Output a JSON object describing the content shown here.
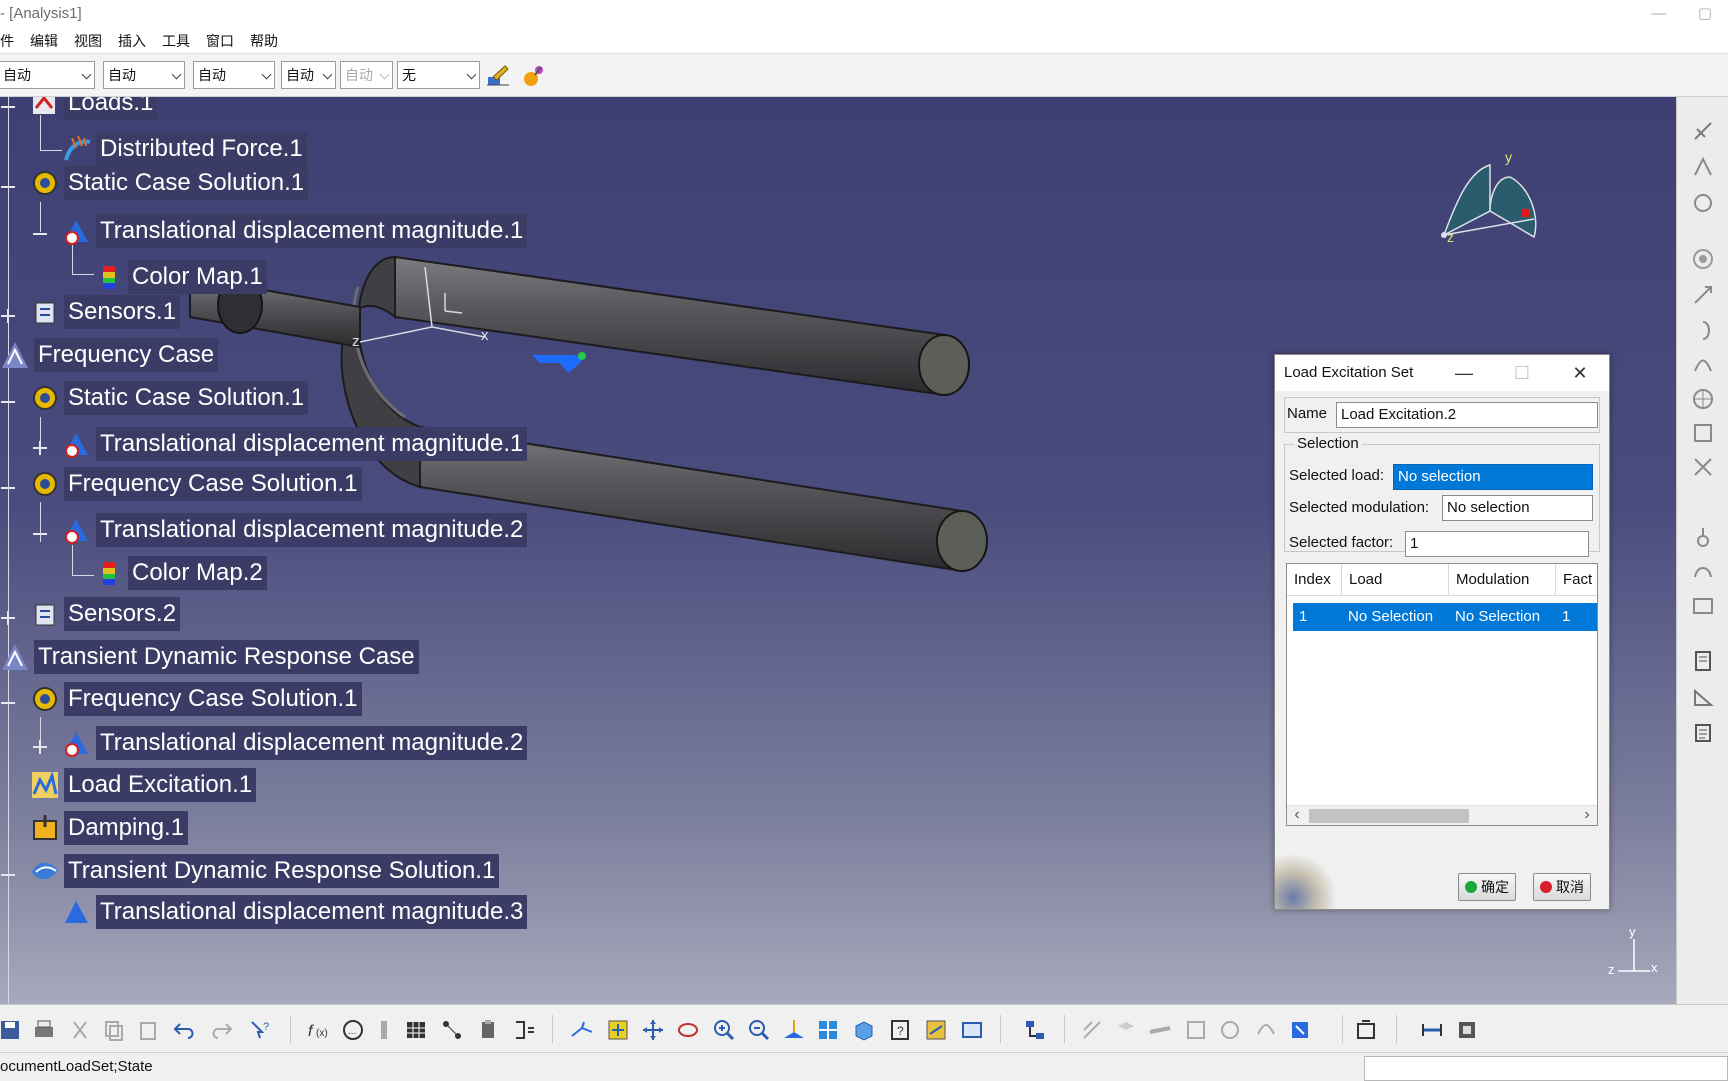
{
  "titlebar": {
    "title": "- [Analysis1]",
    "minimize": "—",
    "maximize": "▢"
  },
  "menu": [
    "件",
    "编辑",
    "视图",
    "插入",
    "工具",
    "窗口",
    "帮助"
  ],
  "toolbar": {
    "combos": [
      {
        "value": "自动",
        "disabled": false
      },
      {
        "value": "自动",
        "disabled": false
      },
      {
        "value": "自动",
        "disabled": false
      },
      {
        "value": "自动",
        "disabled": false
      },
      {
        "value": "自动",
        "disabled": true
      },
      {
        "value": "无",
        "disabled": false
      }
    ],
    "icons": [
      "paint-brush-icon",
      "properties-painter-icon"
    ]
  },
  "tree": {
    "nodes": [
      {
        "label": "Loads.1",
        "icon": "loads-icon",
        "expander": "minus"
      },
      {
        "label": "Distributed Force.1",
        "icon": "distributed-force-icon",
        "expander": ""
      },
      {
        "label": "Static Case Solution.1",
        "icon": "solution-gear-icon",
        "expander": "minus"
      },
      {
        "label": "Translational displacement magnitude.1",
        "icon": "displacement-image-icon",
        "expander": "minus"
      },
      {
        "label": "Color Map.1",
        "icon": "color-map-icon",
        "expander": ""
      },
      {
        "label": "Sensors.1",
        "icon": "sensors-icon",
        "expander": "plus"
      },
      {
        "label": "Frequency Case",
        "icon": "case-icon",
        "expander": ""
      },
      {
        "label": "Static Case Solution.1",
        "icon": "solution-gear-icon",
        "expander": "minus"
      },
      {
        "label": "Translational displacement magnitude.1",
        "icon": "displacement-image-icon",
        "expander": "plus"
      },
      {
        "label": "Frequency Case Solution.1",
        "icon": "solution-gear-icon",
        "expander": "minus"
      },
      {
        "label": "Translational displacement magnitude.2",
        "icon": "displacement-image-icon",
        "expander": "minus"
      },
      {
        "label": "Color Map.2",
        "icon": "color-map-icon",
        "expander": ""
      },
      {
        "label": "Sensors.2",
        "icon": "sensors-icon",
        "expander": "plus"
      },
      {
        "label": "Transient Dynamic Response Case",
        "icon": "case-icon",
        "expander": ""
      },
      {
        "label": "Frequency Case Solution.1",
        "icon": "solution-gear-icon",
        "expander": "minus"
      },
      {
        "label": "Translational displacement magnitude.2",
        "icon": "displacement-image-icon",
        "expander": "plus"
      },
      {
        "label": "Load Excitation.1",
        "icon": "load-excitation-icon",
        "expander": ""
      },
      {
        "label": "Damping.1",
        "icon": "damping-icon",
        "expander": ""
      },
      {
        "label": "Transient Dynamic Response Solution.1",
        "icon": "transient-solution-icon",
        "expander": "minus"
      },
      {
        "label": "Translational displacement magnitude.3",
        "icon": "displacement-image-icon",
        "expander": ""
      }
    ]
  },
  "viewport": {
    "axis_labels": {
      "x": "x",
      "y": "y",
      "z": "z"
    },
    "compass_labels": {
      "y": "y",
      "z": "z"
    },
    "corner_axis_labels": {
      "y": "y",
      "z": "z",
      "x": "x"
    }
  },
  "dialog": {
    "title": "Load Excitation Set",
    "minimize": "—",
    "maximize": "☐",
    "close": "✕",
    "name_label": "Name",
    "name_value": "Load Excitation.2",
    "selection_group": "Selection",
    "selected_load_label": "Selected load:",
    "selected_load_value": "No selection",
    "selected_modulation_label": "Selected modulation:",
    "selected_modulation_value": "No selection",
    "selected_factor_label": "Selected factor:",
    "selected_factor_value": "1",
    "table": {
      "columns": [
        "Index",
        "Load",
        "Modulation",
        "Fact"
      ],
      "rows": [
        {
          "index": "1",
          "load": "No Selection",
          "modulation": "No Selection",
          "factor": "1"
        }
      ]
    },
    "scroll_left": "‹",
    "scroll_right": "›",
    "ok_label": "确定",
    "cancel_label": "取消"
  },
  "statusbar": {
    "text": "ocumentLoadSet;State"
  },
  "colors": {
    "viewport_top": "#3e3f72",
    "tree_label_bg": "#3b3c66",
    "selection_blue": "#0078d7",
    "ok_green": "#1aa83a",
    "cancel_red": "#d8202a"
  }
}
